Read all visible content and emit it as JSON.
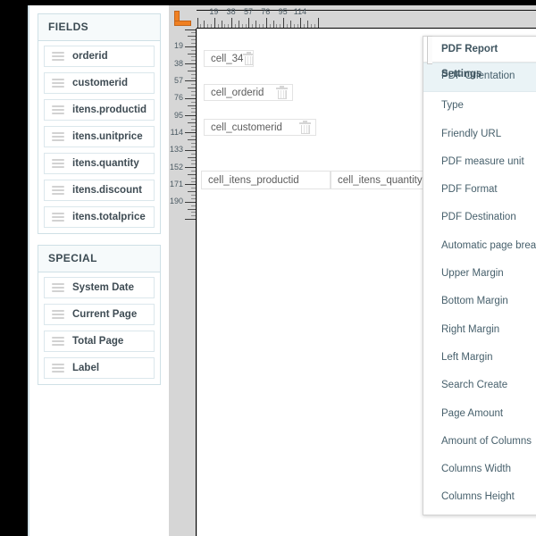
{
  "sidebar": {
    "groups": [
      {
        "title": "FIELDS",
        "items": [
          {
            "label": "orderid"
          },
          {
            "label": "customerid"
          },
          {
            "label": "itens.productid"
          },
          {
            "label": "itens.unitprice"
          },
          {
            "label": "itens.quantity"
          },
          {
            "label": "itens.discount"
          },
          {
            "label": "itens.totalprice"
          }
        ]
      },
      {
        "title": "SPECIAL",
        "items": [
          {
            "label": "System Date"
          },
          {
            "label": "Current Page"
          },
          {
            "label": "Total Page"
          },
          {
            "label": "Label"
          }
        ]
      }
    ]
  },
  "workspace": {
    "corner_icon": "ruler-corner-icon",
    "ruler_h": {
      "labels": [
        "19",
        "38",
        "57",
        "76",
        "95",
        "114"
      ],
      "unit_step": 19
    },
    "ruler_v": {
      "labels": [
        "19",
        "38",
        "57",
        "76",
        "95",
        "114",
        "133",
        "152",
        "171",
        "190"
      ],
      "unit_step": 19
    },
    "cells": [
      {
        "label": "cell_34",
        "delete_icon": "trash-icon"
      },
      {
        "label": "cell_orderid",
        "delete_icon": "trash-icon"
      },
      {
        "label": "cell_customerid",
        "delete_icon": "trash-icon"
      },
      {
        "label": "cell_itens_productid",
        "delete_icon": ""
      },
      {
        "label": "cell_itens_quantity",
        "ghost": "_ite",
        "delete_icon": ""
      }
    ]
  },
  "settings_panel": {
    "title": "PDF Report Settings",
    "items": [
      {
        "label": "PDF Orientation",
        "selected": true
      },
      {
        "label": "Type",
        "selected": false
      },
      {
        "label": "Friendly URL",
        "selected": false
      },
      {
        "label": "PDF measure unit",
        "selected": false
      },
      {
        "label": "PDF Format",
        "selected": false
      },
      {
        "label": "PDF Destination",
        "selected": false
      },
      {
        "label": "Automatic page break",
        "selected": false
      },
      {
        "label": "Upper Margin",
        "selected": false
      },
      {
        "label": "Bottom Margin",
        "selected": false
      },
      {
        "label": "Right Margin",
        "selected": false
      },
      {
        "label": "Left Margin",
        "selected": false
      },
      {
        "label": "Search Create",
        "selected": false
      },
      {
        "label": "Page Amount",
        "selected": false
      },
      {
        "label": "Amount of Columns",
        "selected": false
      },
      {
        "label": "Columns Width",
        "selected": false
      },
      {
        "label": "Columns Height",
        "selected": false
      }
    ]
  },
  "colors": {
    "panel_border": "#cfe0e6",
    "panel_header_bg": "#f6fafb",
    "ruler_bg": "#d6d6d6",
    "accent_orange": "#f08022",
    "settings_highlight": "#eaf3f6",
    "text_teal": "#47606c"
  }
}
